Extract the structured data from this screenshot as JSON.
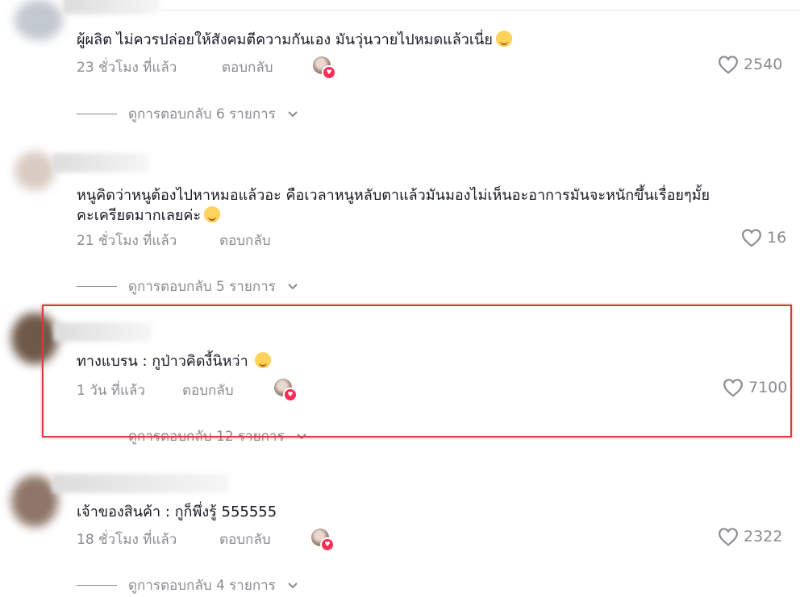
{
  "comments": [
    {
      "text": "ผู้ผลิต ไม่ควรปล่อยให้สังคมตีความกันเอง มันวุ่นวายไปหมดแล้วเนี่ย",
      "time": "23 ชั่วโมง ที่แล้ว",
      "reply": "ตอบกลับ",
      "likes": "2540",
      "view_replies": "ดูการตอบกลับ 6 รายการ",
      "emoji_icon": "smiling-face-emoji"
    },
    {
      "text_line1": "หนูคิดว่าหนูต้องไปหาหมอแล้วอะ คือเวลาหนูหลับตาแล้วมันมองไม่เห็นอะอาการมันจะหนักขึ้นเรื่อยๆมั้ย",
      "text_line2": "คะเครียดมากเลยค่ะ",
      "time": "21 ชั่วโมง ที่แล้ว",
      "reply": "ตอบกลับ",
      "likes": "16",
      "view_replies": "ดูการตอบกลับ 5 รายการ",
      "emoji_icon": "pleading-face-emoji"
    },
    {
      "text": "ทางแบรน : กูป่าวคิดงี้นิหว่า",
      "time": "1 วัน ที่แล้ว",
      "reply": "ตอบกลับ",
      "likes": "7100",
      "view_replies": "ดูการตอบกลับ 12 รายการ",
      "emoji_icon": "rofl-emoji"
    },
    {
      "text": "เจ้าของสินค้า : กูก็พึ่งรู้ 555555",
      "time": "18 ชั่วโมง ที่แล้ว",
      "reply": "ตอบกลับ",
      "likes": "2322",
      "view_replies": "ดูการตอบกลับ 4 รายการ"
    }
  ],
  "colors": {
    "muted": "#8a8b91",
    "highlight": "#d93b3b",
    "heart_badge": "#fe2c55"
  }
}
